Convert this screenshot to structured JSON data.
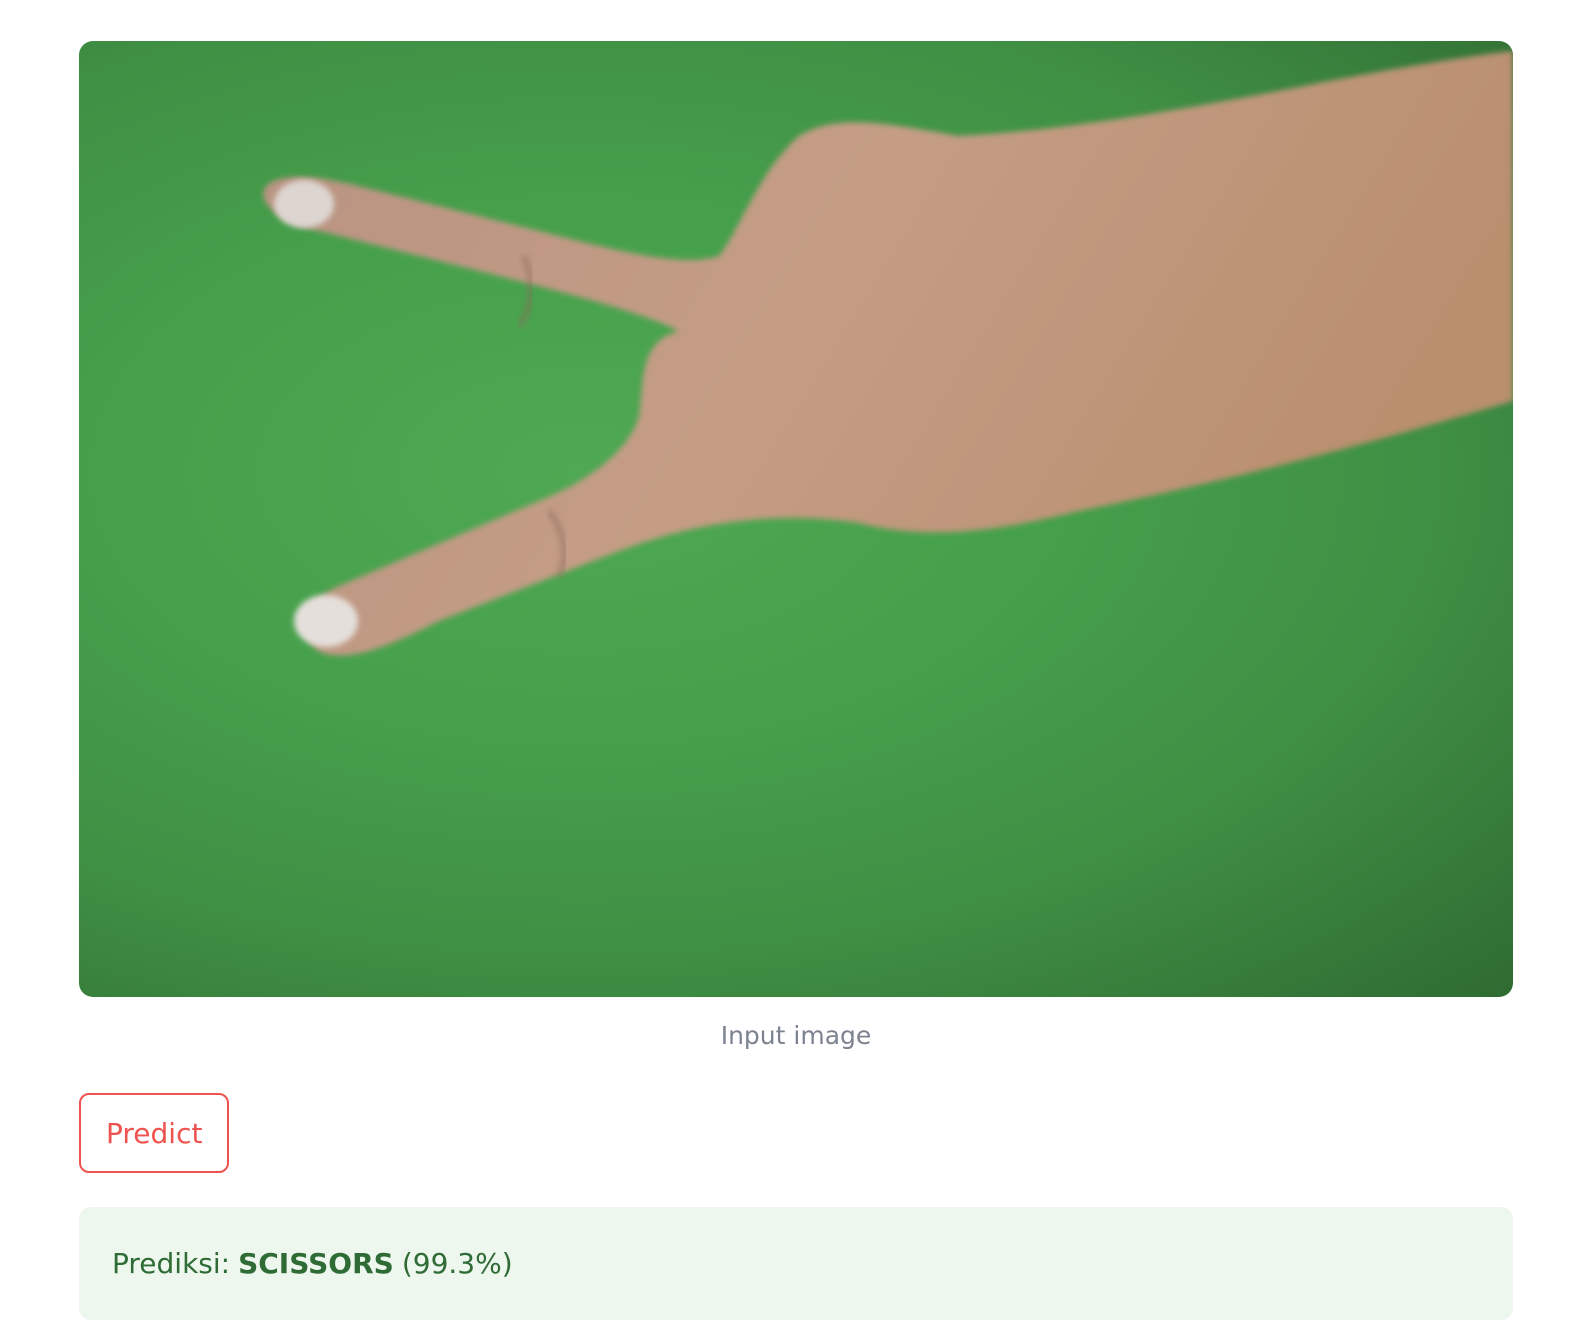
{
  "image": {
    "caption": "Input image",
    "subject": "hand-scissors-gesture-on-green-background",
    "colors": {
      "background": "#46a04b",
      "skin": "#c9a080"
    }
  },
  "actions": {
    "predict_label": "Predict"
  },
  "result": {
    "label": "Prediksi:",
    "class_name": "SCISSORS",
    "confidence": "(99.3%)",
    "colors": {
      "text": "#2e6b35",
      "background": "#eef7ee"
    }
  },
  "theme": {
    "accent": "#ef5350",
    "caption_color": "#7c8290"
  }
}
